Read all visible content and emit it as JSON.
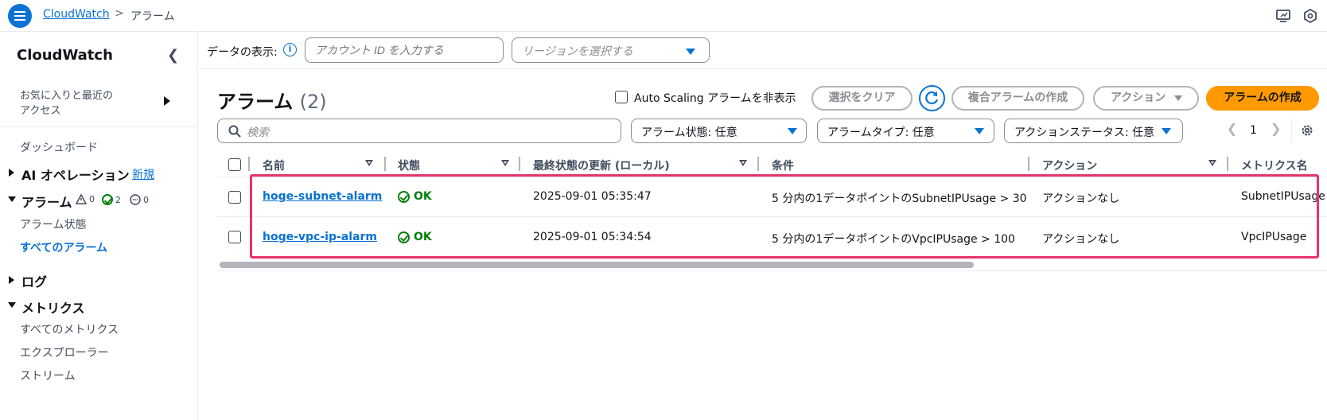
{
  "header": {
    "breadcrumb_root": "CloudWatch",
    "breadcrumb_separator": ">",
    "breadcrumb_current": "アラーム"
  },
  "sidebar": {
    "title": "CloudWatch",
    "favorites": "お気に入りと最近の\nアクセス",
    "dashboard": "ダッシュボード",
    "ai_ops": "AI オペレーション",
    "ai_ops_badge": "新規",
    "alarms": "アラーム",
    "alarm_counts": {
      "alarm": "0",
      "ok": "2",
      "insufficient": "0"
    },
    "alarm_state": "アラーム状態",
    "all_alarms": "すべてのアラーム",
    "logs": "ログ",
    "metrics": "メトリクス",
    "all_metrics": "すべてのメトリクス",
    "explorer": "エクスプローラー",
    "streams": "ストリーム"
  },
  "filterbar": {
    "label": "データの表示:",
    "info": "i",
    "account_placeholder": "アカウント ID を入力する",
    "region_placeholder": "リージョンを選択する"
  },
  "main": {
    "title": "アラーム",
    "count": "(2)",
    "hide_autoscaling": "Auto Scaling アラームを非表示",
    "clear_selection": "選択をクリア",
    "create_composite": "複合アラームの作成",
    "actions": "アクション",
    "create_alarm": "アラームの作成",
    "search_placeholder": "検索",
    "filter_state": "アラーム状態: 任意",
    "filter_type": "アラームタイプ: 任意",
    "filter_action_status": "アクションステータス: 任意",
    "page_number": "1"
  },
  "table": {
    "columns": [
      "名前",
      "状態",
      "最終状態の更新 (ローカル)",
      "条件",
      "アクション",
      "メトリクス名"
    ],
    "rows": [
      {
        "name": "hoge-subnet-alarm",
        "state": "OK",
        "updated": "2025-09-01 05:35:47",
        "condition": "5 分内の1データポイントのSubnetIPUsage > 30",
        "actions": "アクションなし",
        "metric": "SubnetIPUsage"
      },
      {
        "name": "hoge-vpc-ip-alarm",
        "state": "OK",
        "updated": "2025-09-01 05:34:54",
        "condition": "5 分内の1データポイントのVpcIPUsage > 100",
        "actions": "アクションなし",
        "metric": "VpcIPUsage"
      }
    ]
  },
  "colors": {
    "primary_blue": "#0972d3",
    "ok_green": "#037f0c",
    "primary_button": "#ff9900",
    "highlight": "#e8336b"
  }
}
